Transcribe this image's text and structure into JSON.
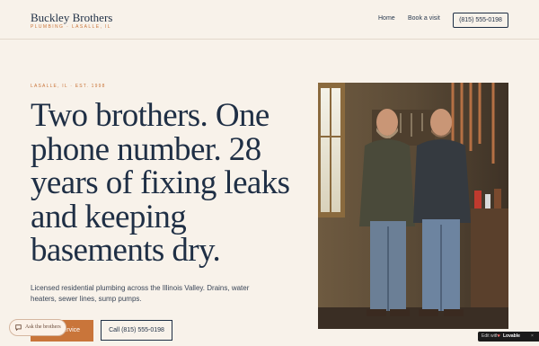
{
  "header": {
    "brand_name": "Buckley Brothers",
    "brand_tagline": "PLUMBING · LASALLE, IL",
    "nav": {
      "home": "Home",
      "book": "Book a visit",
      "phone": "(815) 555-0198"
    }
  },
  "hero": {
    "eyebrow": "LASALLE, IL · EST. 1998",
    "headline": "Two brothers. One phone number. 28 years of fixing leaks and keeping basements dry.",
    "lede": "Licensed residential plumbing across the Illinois Valley. Drains, water heaters, sewer lines, sump pumps.",
    "primary_button": "Book service",
    "secondary_button": "Call (815) 555-0198",
    "photo_icon": "two-plumbers-photo"
  },
  "chat": {
    "label": "Ask the brothers",
    "icon": "chat-bubble-icon"
  },
  "badge": {
    "edit": "Edit with",
    "brand": "Lovable",
    "close": "×"
  },
  "colors": {
    "background": "#f8f2ea",
    "navy": "#1f2f45",
    "accent": "#c9753a"
  }
}
